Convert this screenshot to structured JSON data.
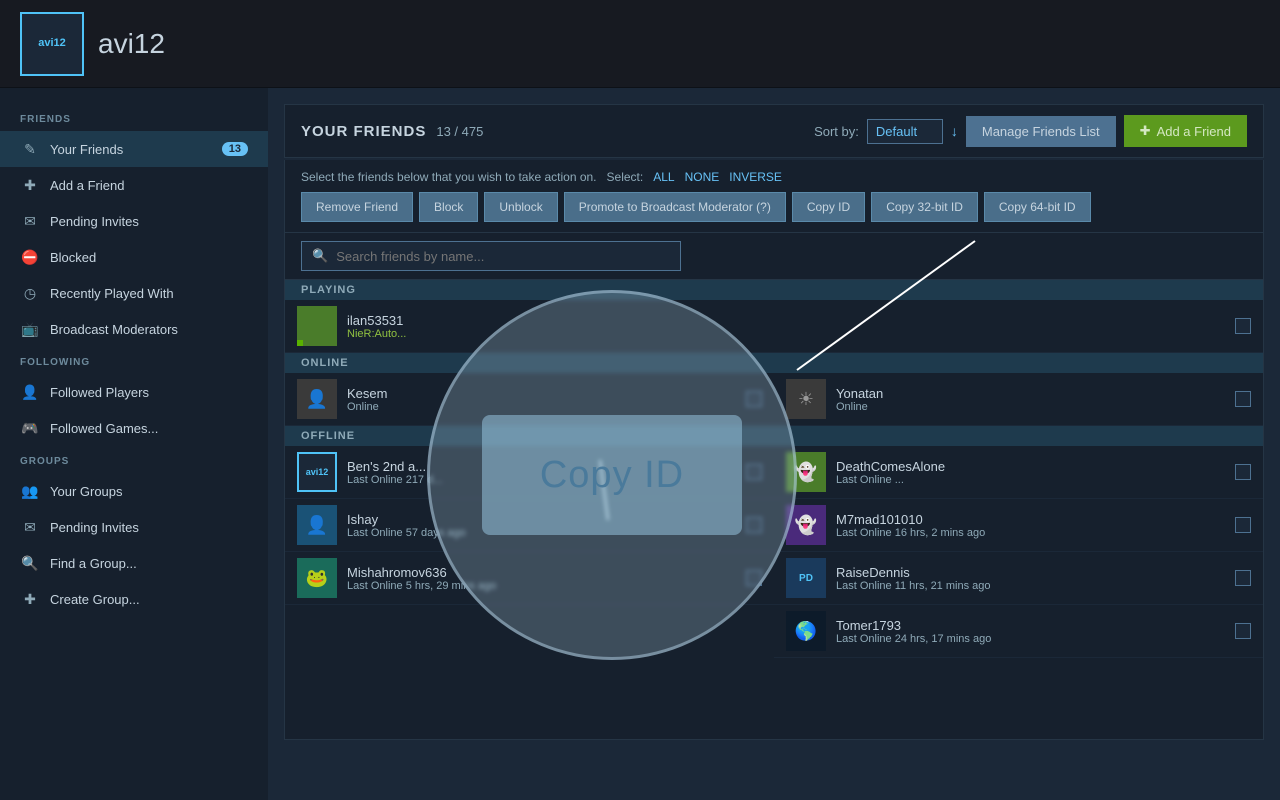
{
  "header": {
    "username": "avi12",
    "avatar_initials": "avi12"
  },
  "sidebar": {
    "friends_section": "FRIENDS",
    "following_section": "FOLLOWING",
    "groups_section": "GROUPS",
    "items": [
      {
        "label": "Your Friends",
        "badge": "13",
        "active": true,
        "icon": "person"
      },
      {
        "label": "Add a Friend",
        "icon": "person-add"
      },
      {
        "label": "Pending Invites",
        "icon": "envelope"
      },
      {
        "label": "Blocked",
        "icon": "blocked"
      },
      {
        "label": "Recently Played With",
        "icon": "clock"
      },
      {
        "label": "Broadcast Moderators",
        "icon": "broadcast"
      },
      {
        "label": "Followed Players",
        "icon": "follow"
      },
      {
        "label": "Followed Games...",
        "icon": "game"
      },
      {
        "label": "Your Groups",
        "icon": "group"
      },
      {
        "label": "Pending Invites",
        "icon": "envelope2"
      },
      {
        "label": "Find a Group...",
        "icon": "search"
      },
      {
        "label": "Create Group...",
        "icon": "create"
      }
    ]
  },
  "friends_panel": {
    "title": "YOUR FRIENDS",
    "count": "13",
    "total": "475",
    "sort_label": "Sort by:",
    "sort_default": "Default",
    "btn_manage": "Manage Friends List",
    "btn_add": "Add a Friend",
    "select_text": "Select the friends below that you wish to take action on.",
    "select_label": "Select:",
    "select_all": "ALL",
    "select_none": "NONE",
    "select_inverse": "INVERSE",
    "buttons": {
      "remove_friend": "Remove Friend",
      "block": "Block",
      "unblock": "Unblock",
      "promote": "Promote to Broadcast Moderator (?)",
      "copy_id": "Copy ID",
      "copy_32bit": "Copy 32-bit ID",
      "copy_64bit": "Copy 64-bit ID"
    },
    "search_placeholder": "Search friends by name...",
    "sections": {
      "playing": "PLAYING",
      "online": "ONLINE",
      "offline": "OFFLINE"
    }
  },
  "friends": {
    "playing": [
      {
        "name": "ilan53531",
        "status": "NieR:Auto...",
        "avatar_color": "av-green",
        "checked": false
      }
    ],
    "online": [
      {
        "name": "Kesem",
        "status": "Online",
        "avatar_color": "av-gray",
        "checked": false
      },
      {
        "name": "Yonatan",
        "status": "Online",
        "avatar_color": "av-gray",
        "checked": false
      }
    ],
    "offline": [
      {
        "name": "Ben's 2nd a...",
        "status": "Last Online 217 d...",
        "avatar_color": "av-avi12",
        "checked": false
      },
      {
        "name": "DeathComesAlone",
        "status": "Last Online ...",
        "avatar_color": "av-green",
        "checked": false
      },
      {
        "name": "Ishay",
        "status": "Last Online 57 days ago",
        "avatar_color": "av-blue",
        "checked": false
      },
      {
        "name": "M7mad101010",
        "status": "Last Online 16 hrs, 2 mins ago",
        "avatar_color": "av-purple",
        "checked": false
      },
      {
        "name": "Mishahromov636",
        "status": "Last Online 5 hrs, 29 mins ago",
        "avatar_color": "av-teal",
        "checked": false
      },
      {
        "name": "RaiseDennis",
        "status": "Last Online 11 hrs, 21 mins ago",
        "avatar_color": "av-blue",
        "checked": false
      },
      {
        "name": "Tomer1793",
        "status": "Last Online 24 hrs, 17 mins ago",
        "avatar_color": "av-dark",
        "checked": false
      }
    ]
  },
  "overlay": {
    "copy_id_label": "Copy ID"
  }
}
